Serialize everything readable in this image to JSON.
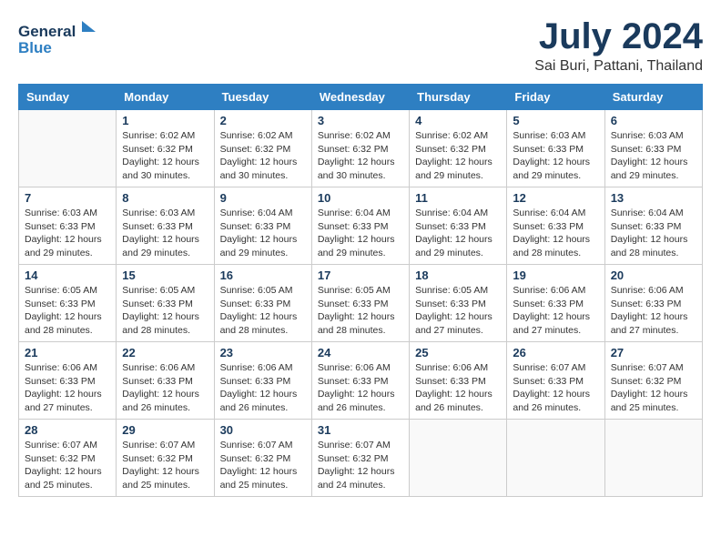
{
  "header": {
    "logo_general": "General",
    "logo_blue": "Blue",
    "month": "July 2024",
    "location": "Sai Buri, Pattani, Thailand"
  },
  "days_of_week": [
    "Sunday",
    "Monday",
    "Tuesday",
    "Wednesday",
    "Thursday",
    "Friday",
    "Saturday"
  ],
  "weeks": [
    [
      {
        "day": "",
        "info": ""
      },
      {
        "day": "1",
        "info": "Sunrise: 6:02 AM\nSunset: 6:32 PM\nDaylight: 12 hours\nand 30 minutes."
      },
      {
        "day": "2",
        "info": "Sunrise: 6:02 AM\nSunset: 6:32 PM\nDaylight: 12 hours\nand 30 minutes."
      },
      {
        "day": "3",
        "info": "Sunrise: 6:02 AM\nSunset: 6:32 PM\nDaylight: 12 hours\nand 30 minutes."
      },
      {
        "day": "4",
        "info": "Sunrise: 6:02 AM\nSunset: 6:32 PM\nDaylight: 12 hours\nand 29 minutes."
      },
      {
        "day": "5",
        "info": "Sunrise: 6:03 AM\nSunset: 6:33 PM\nDaylight: 12 hours\nand 29 minutes."
      },
      {
        "day": "6",
        "info": "Sunrise: 6:03 AM\nSunset: 6:33 PM\nDaylight: 12 hours\nand 29 minutes."
      }
    ],
    [
      {
        "day": "7",
        "info": "Sunrise: 6:03 AM\nSunset: 6:33 PM\nDaylight: 12 hours\nand 29 minutes."
      },
      {
        "day": "8",
        "info": "Sunrise: 6:03 AM\nSunset: 6:33 PM\nDaylight: 12 hours\nand 29 minutes."
      },
      {
        "day": "9",
        "info": "Sunrise: 6:04 AM\nSunset: 6:33 PM\nDaylight: 12 hours\nand 29 minutes."
      },
      {
        "day": "10",
        "info": "Sunrise: 6:04 AM\nSunset: 6:33 PM\nDaylight: 12 hours\nand 29 minutes."
      },
      {
        "day": "11",
        "info": "Sunrise: 6:04 AM\nSunset: 6:33 PM\nDaylight: 12 hours\nand 29 minutes."
      },
      {
        "day": "12",
        "info": "Sunrise: 6:04 AM\nSunset: 6:33 PM\nDaylight: 12 hours\nand 28 minutes."
      },
      {
        "day": "13",
        "info": "Sunrise: 6:04 AM\nSunset: 6:33 PM\nDaylight: 12 hours\nand 28 minutes."
      }
    ],
    [
      {
        "day": "14",
        "info": "Sunrise: 6:05 AM\nSunset: 6:33 PM\nDaylight: 12 hours\nand 28 minutes."
      },
      {
        "day": "15",
        "info": "Sunrise: 6:05 AM\nSunset: 6:33 PM\nDaylight: 12 hours\nand 28 minutes."
      },
      {
        "day": "16",
        "info": "Sunrise: 6:05 AM\nSunset: 6:33 PM\nDaylight: 12 hours\nand 28 minutes."
      },
      {
        "day": "17",
        "info": "Sunrise: 6:05 AM\nSunset: 6:33 PM\nDaylight: 12 hours\nand 28 minutes."
      },
      {
        "day": "18",
        "info": "Sunrise: 6:05 AM\nSunset: 6:33 PM\nDaylight: 12 hours\nand 27 minutes."
      },
      {
        "day": "19",
        "info": "Sunrise: 6:06 AM\nSunset: 6:33 PM\nDaylight: 12 hours\nand 27 minutes."
      },
      {
        "day": "20",
        "info": "Sunrise: 6:06 AM\nSunset: 6:33 PM\nDaylight: 12 hours\nand 27 minutes."
      }
    ],
    [
      {
        "day": "21",
        "info": "Sunrise: 6:06 AM\nSunset: 6:33 PM\nDaylight: 12 hours\nand 27 minutes."
      },
      {
        "day": "22",
        "info": "Sunrise: 6:06 AM\nSunset: 6:33 PM\nDaylight: 12 hours\nand 26 minutes."
      },
      {
        "day": "23",
        "info": "Sunrise: 6:06 AM\nSunset: 6:33 PM\nDaylight: 12 hours\nand 26 minutes."
      },
      {
        "day": "24",
        "info": "Sunrise: 6:06 AM\nSunset: 6:33 PM\nDaylight: 12 hours\nand 26 minutes."
      },
      {
        "day": "25",
        "info": "Sunrise: 6:06 AM\nSunset: 6:33 PM\nDaylight: 12 hours\nand 26 minutes."
      },
      {
        "day": "26",
        "info": "Sunrise: 6:07 AM\nSunset: 6:33 PM\nDaylight: 12 hours\nand 26 minutes."
      },
      {
        "day": "27",
        "info": "Sunrise: 6:07 AM\nSunset: 6:32 PM\nDaylight: 12 hours\nand 25 minutes."
      }
    ],
    [
      {
        "day": "28",
        "info": "Sunrise: 6:07 AM\nSunset: 6:32 PM\nDaylight: 12 hours\nand 25 minutes."
      },
      {
        "day": "29",
        "info": "Sunrise: 6:07 AM\nSunset: 6:32 PM\nDaylight: 12 hours\nand 25 minutes."
      },
      {
        "day": "30",
        "info": "Sunrise: 6:07 AM\nSunset: 6:32 PM\nDaylight: 12 hours\nand 25 minutes."
      },
      {
        "day": "31",
        "info": "Sunrise: 6:07 AM\nSunset: 6:32 PM\nDaylight: 12 hours\nand 24 minutes."
      },
      {
        "day": "",
        "info": ""
      },
      {
        "day": "",
        "info": ""
      },
      {
        "day": "",
        "info": ""
      }
    ]
  ]
}
